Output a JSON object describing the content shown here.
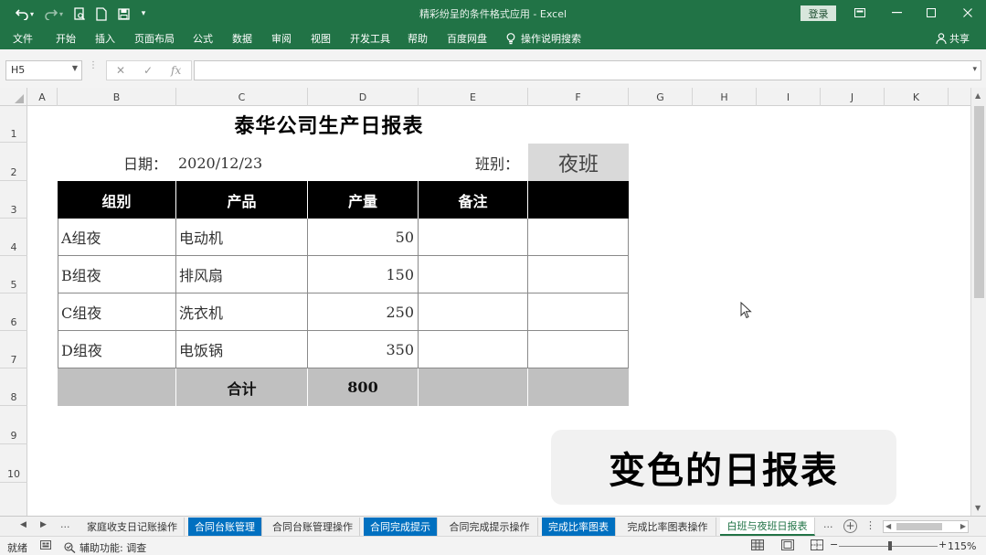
{
  "window": {
    "title": "精彩纷呈的条件格式应用 - Excel",
    "login_label": "登录"
  },
  "ribbon": {
    "tabs": [
      "文件",
      "开始",
      "插入",
      "页面布局",
      "公式",
      "数据",
      "审阅",
      "视图",
      "开发工具",
      "帮助",
      "百度网盘"
    ],
    "tell_me": "操作说明搜索",
    "share_label": "共享"
  },
  "formula_bar": {
    "name_box": "H5",
    "fx_label": "fx",
    "value": ""
  },
  "columns": [
    "A",
    "B",
    "C",
    "D",
    "E",
    "F",
    "G",
    "H",
    "I",
    "J",
    "K"
  ],
  "rows": [
    "1",
    "2",
    "3",
    "4",
    "5",
    "6",
    "7",
    "8",
    "9",
    "10"
  ],
  "report": {
    "title": "泰华公司生产日报表",
    "date_label": "日期：",
    "date_value": "2020/12/23",
    "shift_label": "班别：",
    "shift_value": "夜班",
    "headers": [
      "组别",
      "产品",
      "产量",
      "备注",
      ""
    ],
    "rows": [
      {
        "group": "A组夜",
        "product": "电动机",
        "qty": "50",
        "note": "",
        "extra": ""
      },
      {
        "group": "B组夜",
        "product": "排风扇",
        "qty": "150",
        "note": "",
        "extra": ""
      },
      {
        "group": "C组夜",
        "product": "洗衣机",
        "qty": "250",
        "note": "",
        "extra": ""
      },
      {
        "group": "D组夜",
        "product": "电饭锅",
        "qty": "350",
        "note": "",
        "extra": ""
      }
    ],
    "total_label": "合计",
    "total_value": "800"
  },
  "banner_text": "变色的日报表",
  "sheet_tabs": [
    {
      "label": "家庭收支日记账操作",
      "style": "normal"
    },
    {
      "label": "合同台账管理",
      "style": "highlight"
    },
    {
      "label": "合同台账管理操作",
      "style": "normal"
    },
    {
      "label": "合同完成提示",
      "style": "highlight"
    },
    {
      "label": "合同完成提示操作",
      "style": "normal"
    },
    {
      "label": "完成比率图表",
      "style": "highlight"
    },
    {
      "label": "完成比率图表操作",
      "style": "normal"
    },
    {
      "label": "白班与夜班日报表",
      "style": "active"
    }
  ],
  "tab_overflow": "...",
  "status": {
    "ready": "就绪",
    "accessibility": "辅助功能: 调查",
    "zoom": "115%"
  },
  "colors": {
    "excel_green": "#217346",
    "header_black": "#000000",
    "total_gray": "#c0c0c0",
    "shift_gray": "#d9d9d9",
    "tab_highlight_blue": "#0070c0"
  }
}
